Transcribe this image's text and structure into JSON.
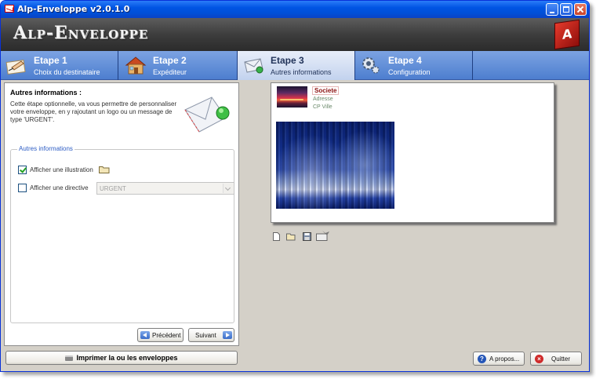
{
  "window": {
    "title": "Alp-Enveloppe v2.0.1.0"
  },
  "banner": {
    "logo_text": "Alp-Enveloppe",
    "logo_badge": "A"
  },
  "tabs": [
    {
      "title": "Etape 1",
      "subtitle": "Choix du destinataire",
      "icon": "writing-hand-icon",
      "active": false
    },
    {
      "title": "Etape 2",
      "subtitle": "Expéditeur",
      "icon": "house-icon",
      "active": false
    },
    {
      "title": "Etape 3",
      "subtitle": "Autres informations",
      "icon": "envelope-icon",
      "active": true
    },
    {
      "title": "Etape 4",
      "subtitle": "Configuration",
      "icon": "gears-icon",
      "active": false
    }
  ],
  "left_panel": {
    "heading": "Autres informations :",
    "description": "Cette étape optionnelle, va vous permettre de personnaliser votre enveloppe, en y rajoutant un logo ou un message de type 'URGENT'.",
    "group_title": "Autres informations",
    "illustration": {
      "label": "Afficher une illustration",
      "checked": true,
      "icon": "folder-icon"
    },
    "directive": {
      "label": "Afficher une directive",
      "checked": false,
      "value": "URGENT"
    },
    "prev_label": "Précédent",
    "next_label": "Suivant"
  },
  "print_label": "Imprimer la ou les enveloppes",
  "preview": {
    "sender_name": "Societe",
    "sender_address": "Adresse",
    "sender_city": "CP Ville"
  },
  "toolbar_icons": [
    "new-file-icon",
    "open-folder-icon",
    "save-icon",
    "open-image-icon"
  ],
  "about_label": "A propos...",
  "quit_label": "Quitter",
  "colors": {
    "title_bar": "#0054e3",
    "tab_bar": "#5a86d2",
    "active_tab": "#dbe4f5",
    "panel_bg": "#d4d0c8"
  }
}
